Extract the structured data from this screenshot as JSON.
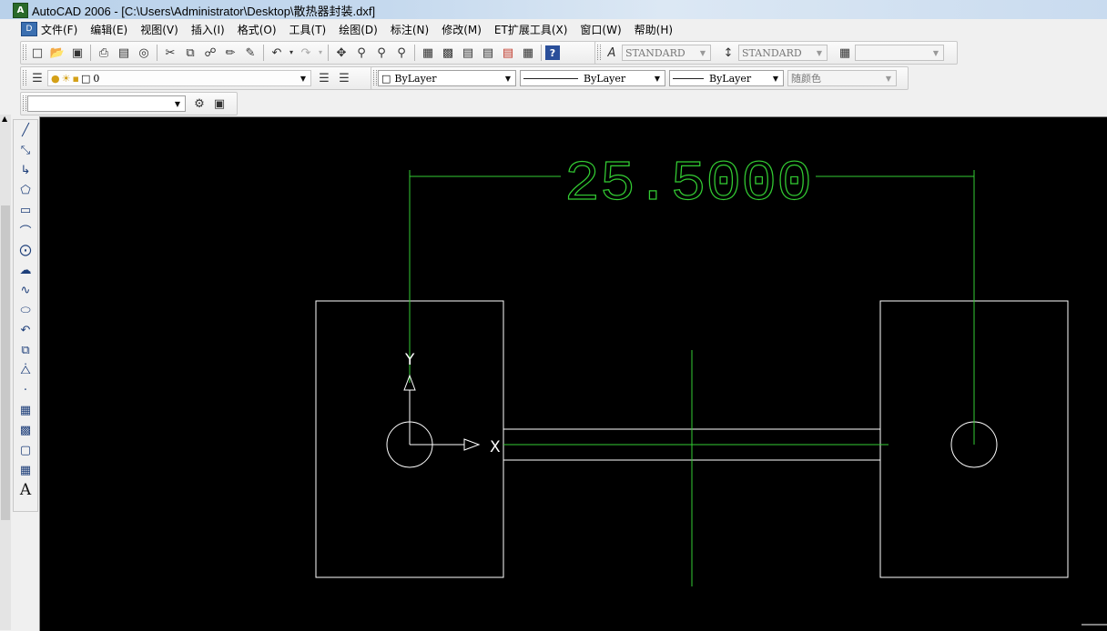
{
  "window": {
    "title": "AutoCAD 2006 - [C:\\Users\\Administrator\\Desktop\\散热器封装.dxf]",
    "app_icon_glyph": "A"
  },
  "menu": {
    "doc_icon_glyph": "D",
    "items": [
      {
        "label": "文件(F)"
      },
      {
        "label": "编辑(E)"
      },
      {
        "label": "视图(V)"
      },
      {
        "label": "插入(I)"
      },
      {
        "label": "格式(O)"
      },
      {
        "label": "工具(T)"
      },
      {
        "label": "绘图(D)"
      },
      {
        "label": "标注(N)"
      },
      {
        "label": "修改(M)"
      },
      {
        "label": "ET扩展工具(X)"
      },
      {
        "label": "窗口(W)"
      },
      {
        "label": "帮助(H)"
      }
    ]
  },
  "standard_toolbar": {
    "text_style": "STANDARD",
    "dim_style": "STANDARD",
    "table_style": ""
  },
  "layers_toolbar": {
    "current_layer": "0"
  },
  "properties_toolbar": {
    "color": "ByLayer",
    "linetype": "ByLayer",
    "lineweight": "ByLayer",
    "plot_style": "随颜色"
  },
  "workspace_toolbar": {
    "value": ""
  },
  "drawing": {
    "dimension_text": "25.5000",
    "ucs_x_label": "X",
    "ucs_y_label": "Y",
    "colors": {
      "background": "#000000",
      "geometry": "#ffffff",
      "dimension": "#33cc33"
    }
  },
  "left_toolbar": {
    "text_tool_glyph": "A"
  }
}
